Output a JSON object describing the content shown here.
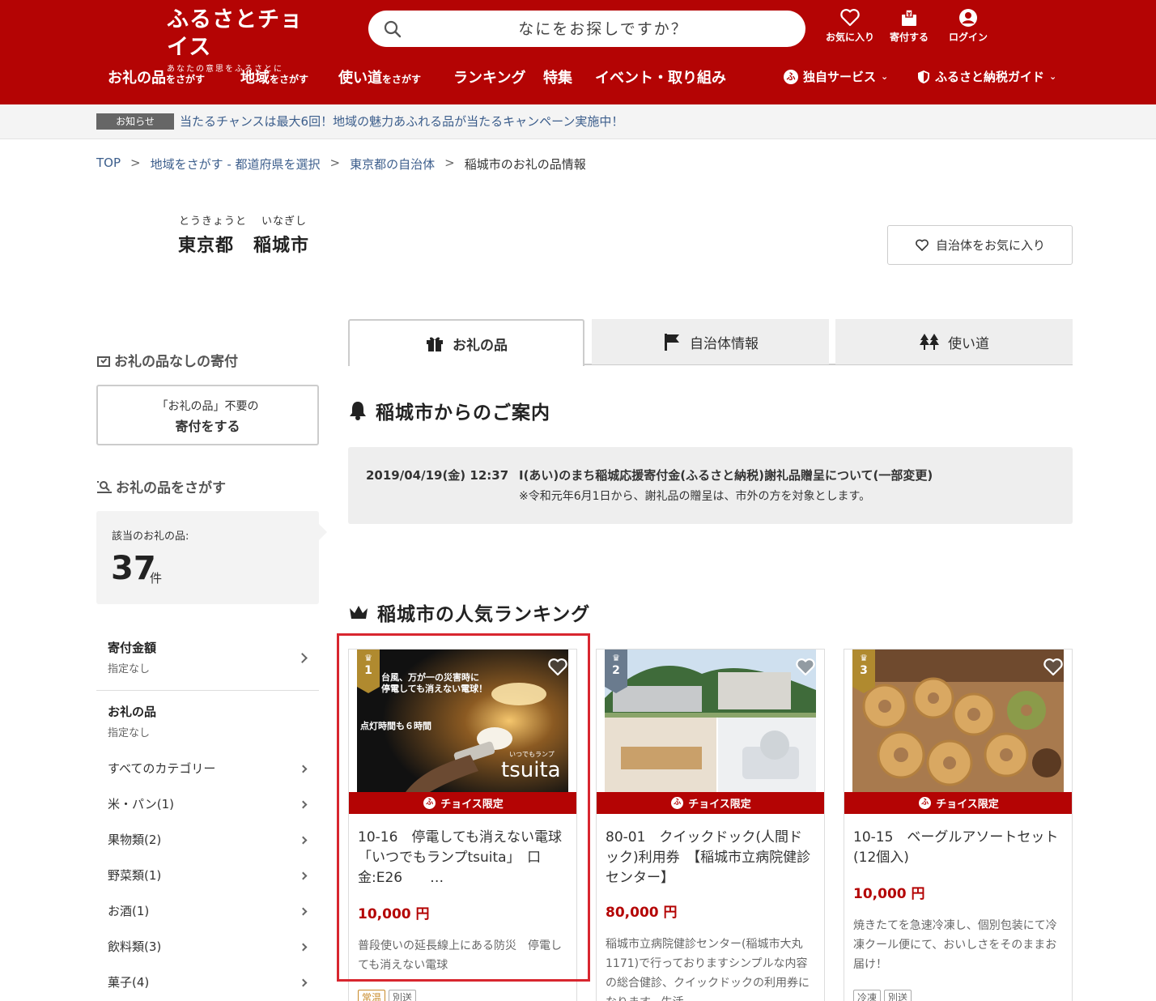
{
  "header": {
    "logo_title": "ふるさとチョイス",
    "logo_tagline": "あなたの意思をふるさとに",
    "search_placeholder": "なにをお探しですか？",
    "favorites_label": "お気に入り",
    "donate_label": "寄付する",
    "login_label": "ログイン",
    "nav": [
      {
        "main": "お礼の品",
        "sub": "をさがす"
      },
      {
        "main": "地域",
        "sub": "をさがす"
      },
      {
        "main": "使い道",
        "sub": "をさがす"
      },
      {
        "main": "ランキング",
        "sub": ""
      },
      {
        "main": "特集",
        "sub": ""
      },
      {
        "main": "イベント・取り組み",
        "sub": ""
      }
    ],
    "services_label": "独自サービス",
    "guide_label": "ふるさと納税ガイド",
    "brand_color": "#b40404"
  },
  "notice": {
    "badge": "お知らせ",
    "text": "当たるチャンスは最大6回！地域の魅力あふれる品が当たるキャンペーン実施中！"
  },
  "breadcrumb": [
    "TOP",
    "地域をさがす - 都道府県を選択",
    "東京都の自治体",
    "稲城市のお礼の品情報"
  ],
  "municipality": {
    "pref_kana": "とうきょうと",
    "pref": "東京都",
    "city_kana": "いなぎし",
    "city": "稲城市",
    "favorite_button": "自治体をお気に入り"
  },
  "sidebar": {
    "no_gift_heading": "お礼の品なしの寄付",
    "no_gift_line1": "「お礼の品」不要の",
    "no_gift_line2": "寄付をする",
    "search_heading": "お礼の品をさがす",
    "count_label": "該当のお礼の品:",
    "count": "37",
    "count_unit": "件",
    "filters": [
      {
        "title": "寄付金額",
        "value": "指定なし"
      },
      {
        "title": "お礼の品",
        "value": "指定なし"
      }
    ],
    "categories": [
      "すべてのカテゴリー",
      "米・パン(1)",
      "果物類(2)",
      "野菜類(1)",
      "お酒(1)",
      "飲料類(3)",
      "菓子(4)"
    ]
  },
  "tabs": [
    "お礼の品",
    "自治体情報",
    "使い道"
  ],
  "announcement": {
    "heading": "稲城市からのご案内",
    "date": "2019/04/19(金) 12:37",
    "title": "I(あい)のまち稲城応援寄付金(ふるさと納税)謝礼品贈呈について(一部変更)",
    "note": "※令和元年6月1日から、謝礼品の贈呈は、市外の方を対象とします。"
  },
  "ranking": {
    "heading": "稲城市の人気ランキング",
    "limited_label": "チョイス限定",
    "items": [
      {
        "rank": "1",
        "image_text_1": "台風、万が一の災害時に",
        "image_text_2": "停電しても消えない電球！",
        "image_text_3": "点灯時間も６時間",
        "image_brand_small": "いつでもランプ",
        "image_brand": "tsuita",
        "title": "10-16　停電しても消えない電球「いつでもランプtsuita」　口金:E26　　…",
        "price": "10,000 円",
        "desc": "普段使いの延長線上にある防災　停電しても消えない電球",
        "tags": [
          "常温",
          "別送"
        ]
      },
      {
        "rank": "2",
        "title": "80-01　クイックドック(人間ドック)利用券　【稲城市立病院健診センター】",
        "price": "80,000 円",
        "desc": "稲城市立病院健診センター(稲城市大丸1171)で行っておりますシンプルな内容の総合健診、クイックドックの利用券になります。生活",
        "tags": []
      },
      {
        "rank": "3",
        "title": "10-15　ベーグルアソートセット(12個入)",
        "price": "10,000 円",
        "desc": "焼きたてを急速冷凍し、個別包装にて冷凍クール便にて、おいしさをそのままお届け！",
        "tags": [
          "冷凍",
          "別送"
        ]
      }
    ]
  }
}
